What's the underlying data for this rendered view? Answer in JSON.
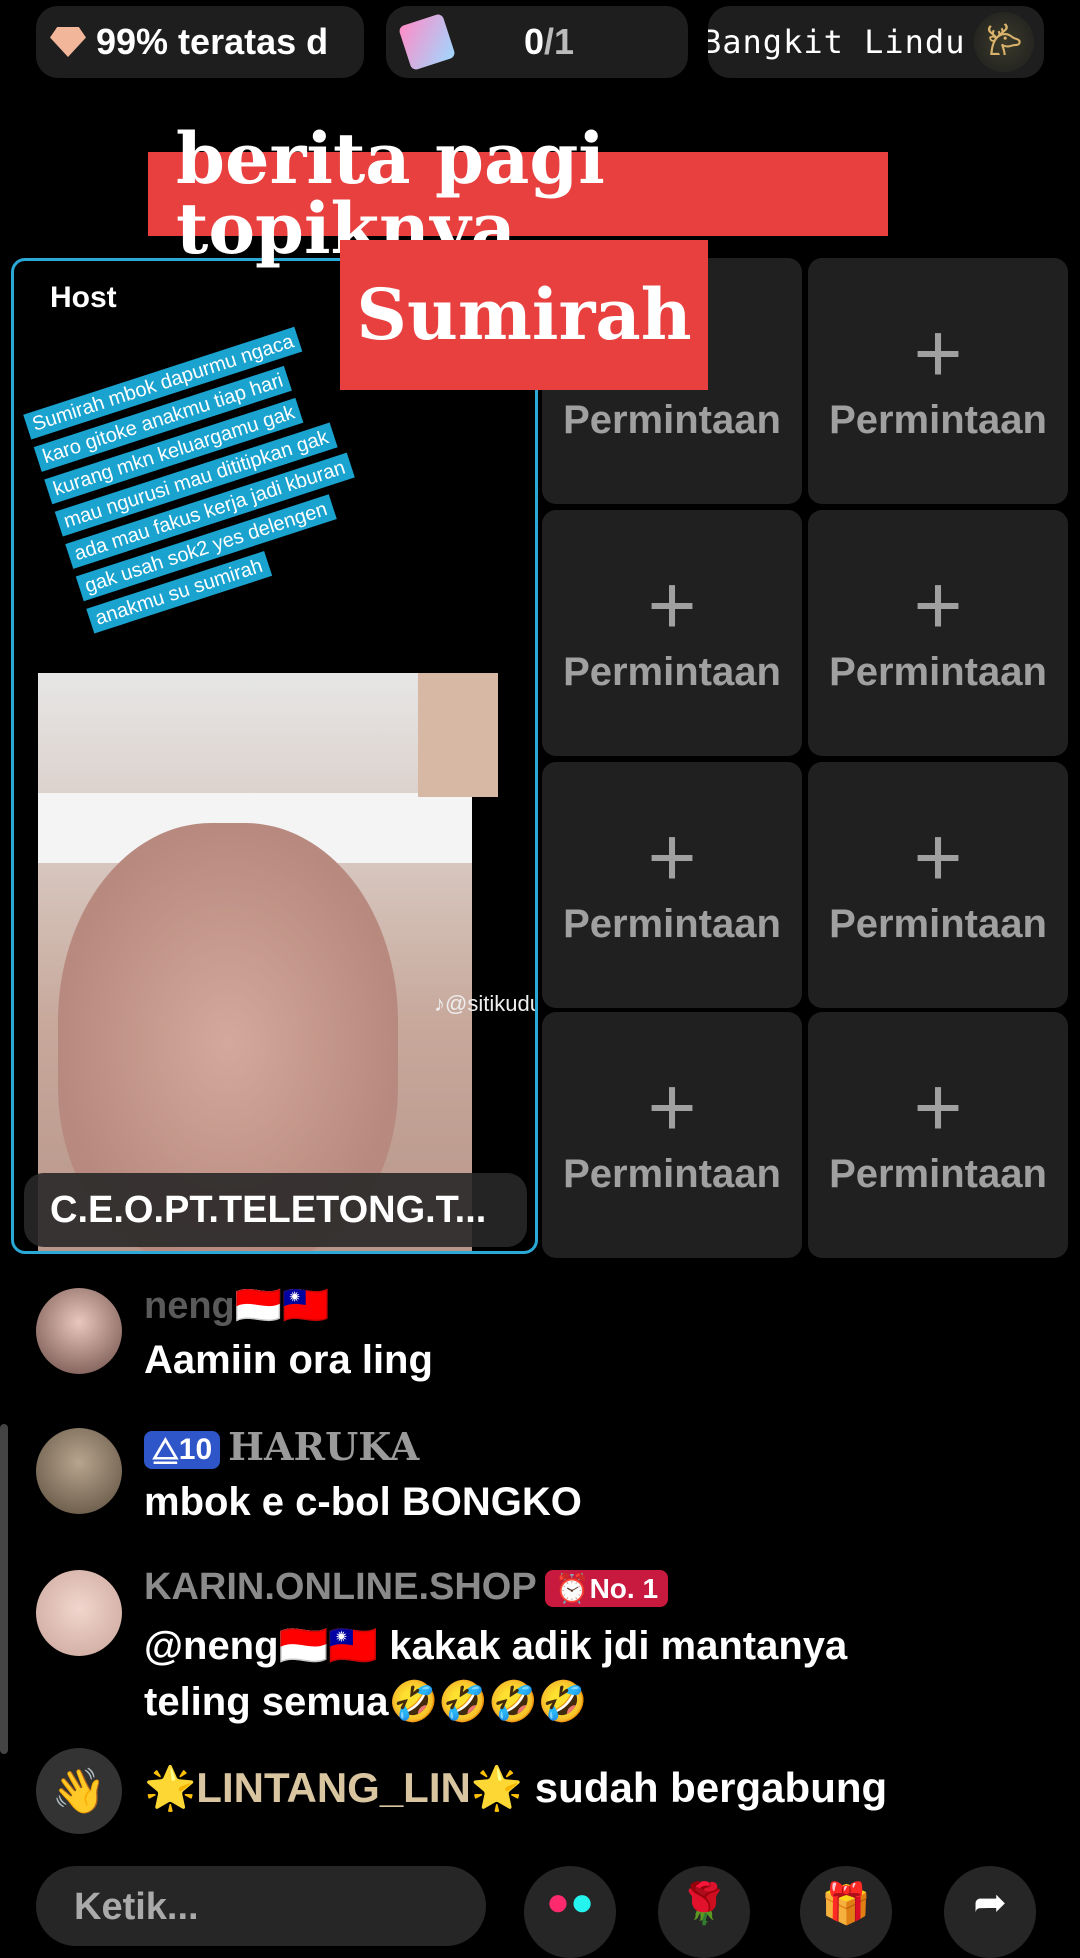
{
  "top": {
    "rank": "99% teratas d",
    "progress_num": "0",
    "progress_den": "/1",
    "gift_names": "Bangkit   Lindu"
  },
  "banner": {
    "line1": "berita pagi topiknya",
    "line2": "Sumirah"
  },
  "host": {
    "label": "Host",
    "overlay_lines": [
      "Sumirah mbok dapurmu ngaca",
      "karo gitoke anakmu tiap hari",
      "kurang mkn  keluargamu gak",
      "mau ngurusi  mau dititipkan gak",
      "ada mau  fakus kerja jadi kburan",
      "gak usah sok2 yes  delengen",
      "anakmu su sumirah"
    ],
    "watermark": "♪@sitikudu",
    "name": "C.E.O.PT.TELETONG.T..."
  },
  "slots": {
    "plus": "+",
    "label": "Permintaan"
  },
  "chat": [
    {
      "name": "neng🇮🇩🇹🇼",
      "message": "Aamiin ora ling"
    },
    {
      "level": "10",
      "name": "HARUKA",
      "message": "mbok e c-bol BONGKO"
    },
    {
      "name": "KARIN.ONLINE.SHOP",
      "badge": "No. 1",
      "message": "@neng🇮🇩🇹🇼 kakak adik jdi mantanya",
      "message2": "teling semua🤣🤣🤣🤣"
    }
  ],
  "join": {
    "name": "🌟LINTANG_LIN🌟",
    "text": " sudah bergabung"
  },
  "input": {
    "placeholder": "Ketik..."
  },
  "colors": {
    "banner": "#e8403f",
    "host_border": "#2aa9d6",
    "overlay_bg": "#1aa3cf",
    "level_badge": "#2f56c9",
    "no1_badge": "#c8193e"
  }
}
